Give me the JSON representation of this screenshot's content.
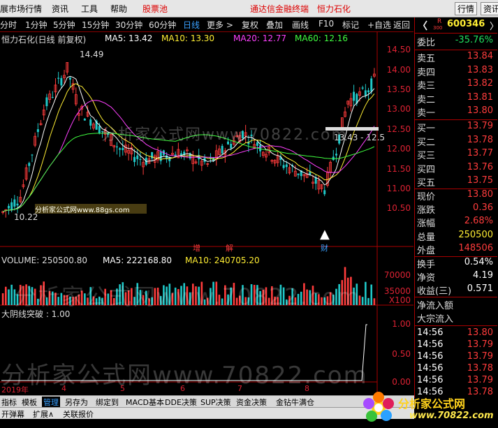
{
  "menubar": {
    "items": [
      "展市场行情",
      "资讯",
      "工具",
      "帮助"
    ],
    "stockpool": "股票池",
    "app_title": "通达信金融终端",
    "stock_name": "恒力石化",
    "right_buttons": [
      "行情",
      "资讯"
    ]
  },
  "periodbar": {
    "items": [
      "分时",
      "1分钟",
      "5分钟",
      "15分钟",
      "30分钟",
      "60分钟",
      "日线",
      "更多 >",
      "复权",
      "叠加",
      "画线",
      "F10",
      "标记",
      "+自选",
      "返回"
    ],
    "selected": "日线"
  },
  "legend": {
    "title": "恒力石化(日线 前复权)",
    "ma5": "MA5: 13.42",
    "ma10": "MA10: 13.30",
    "ma20": "MA20: 12.77",
    "ma60": "MA60: 12.16"
  },
  "price_axis": [
    "14.50",
    "14.00",
    "13.50",
    "13.00",
    "12.50",
    "12.00",
    "11.50",
    "11.00",
    "10.50"
  ],
  "annotations": {
    "high": "14.49",
    "low": "10.22",
    "range_label": "13.43 - 12.5",
    "flag_zeng": "增",
    "flag_jie": "解",
    "flag_cai": "财"
  },
  "volume": {
    "label": "VOLUME: 250500.80",
    "ma5": "MA5: 222168.80",
    "ma10": "MA10: 240705.20",
    "axis": [
      "70000",
      "35000",
      "X100"
    ]
  },
  "indicator": {
    "label": "大阴线突破 : 1.00",
    "axis": [
      "1.00",
      "0.50",
      "0.00"
    ]
  },
  "timeline": [
    "2019年",
    "4",
    "5",
    "6",
    "7",
    "8"
  ],
  "quote": {
    "code": "600346",
    "badge_r": "R",
    "badge_300": "300",
    "weibi_label": "委比",
    "weibi_value": "-35.76%",
    "sells": [
      {
        "label": "卖五",
        "price": "13.84"
      },
      {
        "label": "卖四",
        "price": "13.83"
      },
      {
        "label": "卖三",
        "price": "13.82"
      },
      {
        "label": "卖二",
        "price": "13.81"
      },
      {
        "label": "卖一",
        "price": "13.80"
      }
    ],
    "buys": [
      {
        "label": "买一",
        "price": "13.79"
      },
      {
        "label": "买二",
        "price": "13.78"
      },
      {
        "label": "买三",
        "price": "13.77"
      },
      {
        "label": "买四",
        "price": "13.76"
      },
      {
        "label": "买五",
        "price": "13.75"
      }
    ],
    "stats": [
      {
        "label": "现价",
        "value": "13.80",
        "color": "#ff3c3c"
      },
      {
        "label": "涨跌",
        "value": "0.36",
        "color": "#ff3c3c"
      },
      {
        "label": "涨幅",
        "value": "2.68%",
        "color": "#ff3c3c"
      },
      {
        "label": "总量",
        "value": "250500",
        "color": "#ffee33"
      },
      {
        "label": "外盘",
        "value": "148506",
        "color": "#ff3c3c"
      }
    ],
    "stats2": [
      {
        "label": "换手",
        "value": "0.54%",
        "color": "#ffffff"
      },
      {
        "label": "净资",
        "value": "4.19",
        "color": "#ffffff"
      },
      {
        "label": "收益(三)",
        "value": "0.571",
        "color": "#ffffff"
      }
    ],
    "flow1": "净流入额",
    "flow2": "大宗流入",
    "ticks": [
      {
        "time": "14:56",
        "price": "13.80"
      },
      {
        "time": "14:56",
        "price": "13.79"
      },
      {
        "time": "14:56",
        "price": "13.79"
      },
      {
        "time": "14:56",
        "price": "13.78"
      },
      {
        "time": "14:56",
        "price": "13.79"
      },
      {
        "time": "14:56",
        "price": "13.78"
      }
    ]
  },
  "bottomtabs": [
    "指标",
    "模板",
    "管理",
    "另存为",
    "绑定到",
    "MACD基本",
    "DDE决策",
    "SUP决策",
    "资金决策",
    "金钻牛满仓"
  ],
  "bottomtab_active": "管理",
  "bottombar2": [
    "开弹幕",
    "扩展∧",
    "关联报价"
  ],
  "watermark": {
    "line1": "分析家公式网www.70822.com",
    "small": "分析家公式网www.88gs.com",
    "big": "分析家公式网www.70822.com"
  },
  "logo": {
    "line1": "分析家公式网",
    "line2": "www.70822.com"
  },
  "colors": {
    "up": "#ff3c3c",
    "down": "#20c8c8",
    "ma5": "#ffffff",
    "ma10": "#ffee33",
    "ma20": "#ff40ff",
    "ma60": "#40ff40"
  }
}
